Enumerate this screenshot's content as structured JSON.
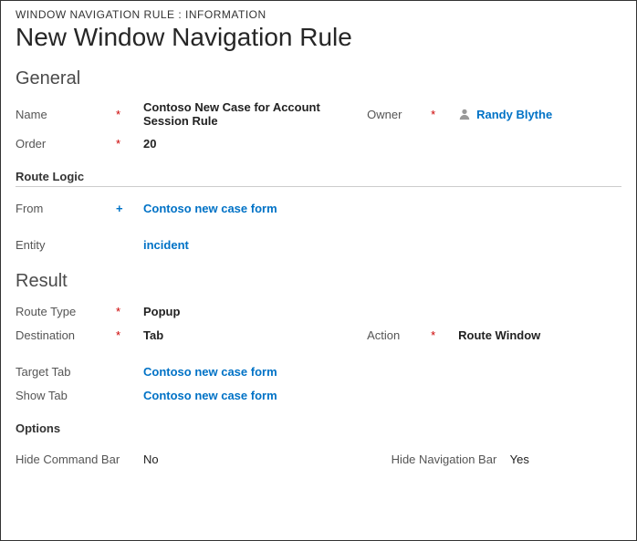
{
  "breadcrumb": "WINDOW NAVIGATION RULE : INFORMATION",
  "title": "New Window Navigation Rule",
  "sections": {
    "general": {
      "heading": "General",
      "name": {
        "label": "Name",
        "value": "Contoso New Case for Account Session Rule",
        "req": "*"
      },
      "owner": {
        "label": "Owner",
        "value": "Randy Blythe",
        "req": "*"
      },
      "order": {
        "label": "Order",
        "value": "20",
        "req": "*"
      },
      "routeLogic": {
        "heading": "Route Logic",
        "from": {
          "label": "From",
          "value": "Contoso new case form",
          "req": "+"
        },
        "entity": {
          "label": "Entity",
          "value": "incident",
          "req": ""
        }
      }
    },
    "result": {
      "heading": "Result",
      "routeType": {
        "label": "Route Type",
        "value": "Popup",
        "req": "*"
      },
      "destination": {
        "label": "Destination",
        "value": "Tab",
        "req": "*"
      },
      "action": {
        "label": "Action",
        "value": "Route Window",
        "req": "*"
      },
      "targetTab": {
        "label": "Target Tab",
        "value": "Contoso new case form",
        "req": ""
      },
      "showTab": {
        "label": "Show Tab",
        "value": "Contoso new case form",
        "req": ""
      },
      "options": {
        "heading": "Options",
        "hideCommandBar": {
          "label": "Hide Command Bar",
          "value": "No"
        },
        "hideNavBar": {
          "label": "Hide Navigation Bar",
          "value": "Yes"
        }
      }
    }
  }
}
